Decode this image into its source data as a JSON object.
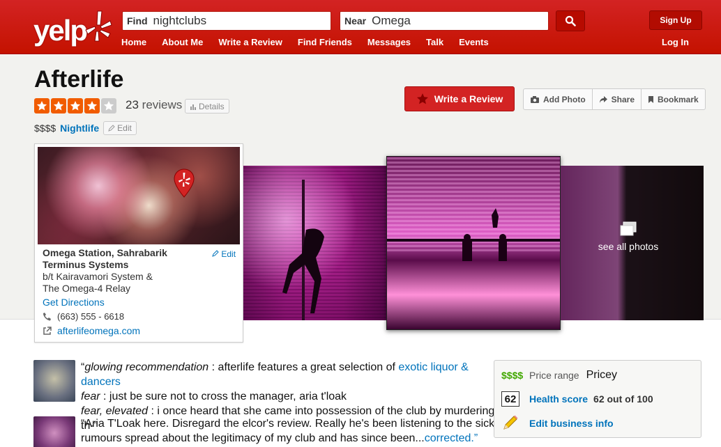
{
  "header": {
    "logo_text": "yelp",
    "find_label": "Find",
    "find_value": "nightclubs",
    "near_label": "Near",
    "near_value": "Omega",
    "nav": [
      "Home",
      "About Me",
      "Write a Review",
      "Find Friends",
      "Messages",
      "Talk",
      "Events"
    ],
    "sign_up": "Sign Up",
    "log_in": "Log In"
  },
  "business": {
    "name": "Afterlife",
    "rating_stars": 4,
    "rating_max": 5,
    "review_count": "23",
    "reviews_word": "reviews",
    "details_label": "Details",
    "price": "$$$$",
    "category": "Nightlife",
    "edit_label": "Edit"
  },
  "actions": {
    "write_review": "Write a Review",
    "add_photo": "Add Photo",
    "share": "Share",
    "bookmark": "Bookmark"
  },
  "location": {
    "line1": "Omega Station, Sahrabarik",
    "line2": "Terminus Systems",
    "line3": "b/t Kairavamori System &",
    "line4": "The Omega-4 Relay",
    "edit": "Edit",
    "directions": "Get Directions",
    "phone": "(663) 555 - 6618",
    "website": "afterlifeomega.com"
  },
  "photos": {
    "see_all": "see all photos"
  },
  "reviews": [
    {
      "l1_quote_open": "“",
      "l1_label": "glowing recommendation",
      "l1_text": " : afterlife features a great selection of ",
      "l1_link": "exotic liquor & dancers",
      "l2_label": "fear",
      "l2_text": " : just be sure not to cross the manager, aria t'loak",
      "l3_label": "fear, elevated",
      "l3_text": " : i once heard that she came into possession of the club by murdering th-”"
    },
    {
      "l1": "“Aria T'Loak here. Disregard the elcor's review. Really he's been listening to the sick",
      "l2": "rumours spread about the legitimacy of my club and has since been...",
      "l2_link": "corrected.",
      "l2_close": "”"
    }
  ],
  "info": {
    "price_symbol": "$$$$",
    "price_label": "Price range",
    "price_value": "Pricey",
    "health_score_value": "62",
    "health_label": "Health score",
    "health_text": "62 out of 100",
    "edit_info": "Edit business info"
  },
  "colors": {
    "brand_red": "#d32323",
    "link_blue": "#0073bb",
    "star_orange": "#f15c00",
    "price_green": "#41a700"
  }
}
